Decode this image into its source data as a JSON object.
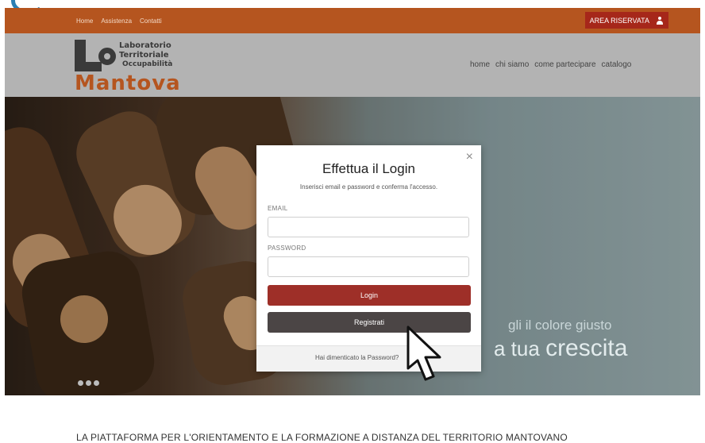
{
  "topbar": {
    "links": [
      "Home",
      "Assistenza",
      "Contatti"
    ],
    "area_label": "AREA RISERVATA",
    "user_icon": "user-icon"
  },
  "logo": {
    "line1": "Laboratorio",
    "line2": "Territoriale",
    "line3": "Occupabilità",
    "city": "Mantova"
  },
  "nav": {
    "items": [
      "home",
      "chi siamo",
      "come partecipare",
      "catalogo"
    ]
  },
  "hero": {
    "slogan_line1": "gli il colore giusto",
    "slogan_line2_prefix": "a tua",
    "slogan_line2_big": "crescita"
  },
  "modal": {
    "title": "Effettua il Login",
    "subtitle": "Inserisci email e password e conferma l'accesso.",
    "email_label": "EMAIL",
    "password_label": "PASSWORD",
    "login_label": "Login",
    "register_label": "Registrati",
    "forgot_label": "Hai dimenticato la Password?",
    "close_glyph": "×"
  },
  "tagline": "LA PIATTAFORMA PER L'ORIENTAMENTO E LA FORMAZIONE A DISTANZA DEL TERRITORIO MANTOVANO",
  "colors": {
    "topbar": "#b5551f",
    "area_button": "#a6271a",
    "login_button": "#9e2f28",
    "register_button": "#4b4545"
  }
}
